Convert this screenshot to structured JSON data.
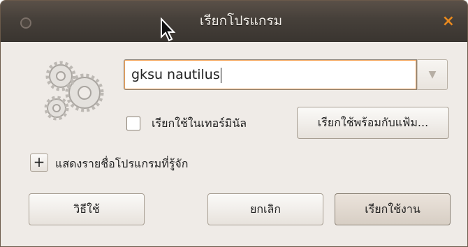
{
  "window": {
    "title": "เรียกโปรแกรม",
    "close_glyph": "×"
  },
  "input": {
    "value": "gksu nautilus"
  },
  "combo": {
    "arrow_glyph": "▼"
  },
  "terminal_checkbox": {
    "label": "เรียกใช้ในเทอร์มินัล",
    "checked": false
  },
  "buttons": {
    "run_with_file": "เรียกใช้พร้อมกับแฟ้ม...",
    "help": "วิธีใช้",
    "cancel": "ยกเลิก",
    "run": "เรียกใช้งาน"
  },
  "expander": {
    "glyph": "+",
    "label": "แสดงรายชื่อโปรแกรมที่รู้จัก"
  },
  "colors": {
    "titlebar": "#46403a",
    "close_accent": "#e8891e",
    "dialog_bg": "#efebe7",
    "focus_ring": "#f0a35a"
  },
  "icons": [
    "app-gears-icon",
    "close-icon",
    "dropdown-arrow-icon",
    "mouse-cursor-icon",
    "window-menu-icon"
  ]
}
